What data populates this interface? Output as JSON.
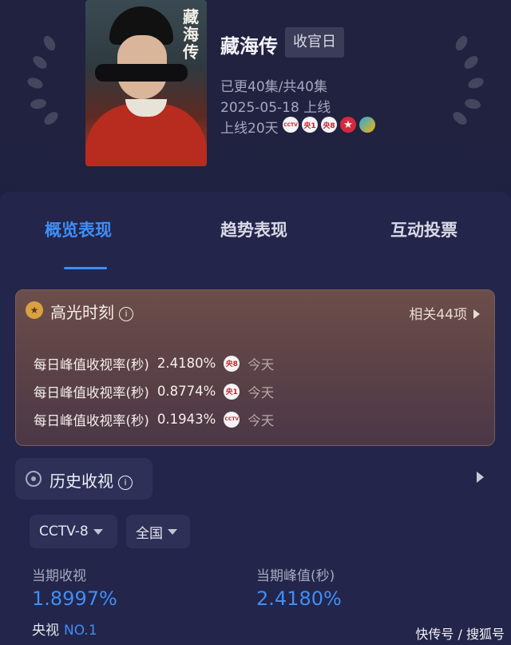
{
  "show": {
    "poster_title": "藏海传",
    "title": "藏海传",
    "tag": "收官日",
    "episodes": "已更40集/共40集",
    "date": "2025-05-18 上线",
    "online_days": "上线20天",
    "channels": [
      {
        "name": "cctv-icon",
        "label": "CCTV"
      },
      {
        "name": "cctv1-icon",
        "label": "央1"
      },
      {
        "name": "cctv8-icon",
        "label": "央8"
      },
      {
        "name": "star-icon",
        "label": "★"
      },
      {
        "name": "mango-icon",
        "label": ""
      }
    ]
  },
  "tabs": [
    {
      "label": "概览表现",
      "active": true
    },
    {
      "label": "趋势表现",
      "active": false
    },
    {
      "label": "互动投票",
      "active": false
    }
  ],
  "highlights": {
    "title": "高光时刻",
    "count": "相关44项",
    "rows": [
      {
        "label": "每日峰值收视率(秒)",
        "value": "2.4180%",
        "channel": "央8",
        "day": "今天"
      },
      {
        "label": "每日峰值收视率(秒)",
        "value": "0.8774%",
        "channel": "央1",
        "day": "今天"
      },
      {
        "label": "每日峰值收视率(秒)",
        "value": "0.1943%",
        "channel": "CCTV",
        "day": "今天"
      }
    ]
  },
  "history": {
    "title": "历史收视",
    "filters": {
      "channel": "CCTV-8",
      "region": "全国"
    },
    "current_label": "当期收视",
    "current_value": "1.8997%",
    "peak_label": "当期峰值(秒)",
    "peak_value": "2.4180%",
    "rank_prefix": "央视",
    "rank_value": "NO.1"
  },
  "watermark": "快传号 / 搜狐号",
  "colors": {
    "accent": "#3f8ef7",
    "background": "#1d1f3a"
  }
}
